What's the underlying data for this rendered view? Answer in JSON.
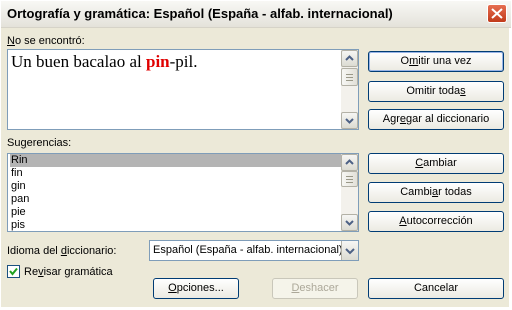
{
  "window": {
    "title": "Ortografía y gramática: Español (España - alfab. internacional)"
  },
  "not_found": {
    "label_u": "N",
    "label_rest": "o se encontró:",
    "text_before": "Un buen bacalao al ",
    "text_error": "pin",
    "text_after": "-pil."
  },
  "suggestions": {
    "label_pre": "Su",
    "label_u": "g",
    "label_rest": "erencias:",
    "items": [
      "Rin",
      "fin",
      "gin",
      "pan",
      "pie",
      "pis"
    ]
  },
  "buttons": {
    "omitir_una_vez": {
      "pre": "O",
      "u": "m",
      "rest": "itir una vez"
    },
    "omitir_todas": {
      "pre": "Omitir toda",
      "u": "s",
      "rest": ""
    },
    "agregar": {
      "pre": "Agr",
      "u": "e",
      "rest": "gar al diccionario"
    },
    "cambiar": {
      "pre": "",
      "u": "C",
      "rest": "ambiar"
    },
    "cambiar_todas": {
      "pre": "Cambi",
      "u": "a",
      "rest": "r todas"
    },
    "autocorreccion": {
      "pre": "",
      "u": "A",
      "rest": "utocorrección"
    },
    "opciones": {
      "pre": "",
      "u": "O",
      "rest": "pciones..."
    },
    "deshacer": {
      "pre": "",
      "u": "D",
      "rest": "eshacer"
    },
    "cancelar": {
      "label": "Cancelar"
    }
  },
  "dictionary": {
    "label_pre": "Idioma del ",
    "label_u": "d",
    "label_rest": "iccionario:",
    "selected": "Español (España - alfab. internacional)"
  },
  "grammar_check": {
    "label_pre": "Re",
    "label_u": "v",
    "label_rest": "isar gramática",
    "checked": true
  },
  "colors": {
    "error_text": "#e00000",
    "selected_item": "#b4b4b4",
    "close_button": "#c13a1a"
  }
}
